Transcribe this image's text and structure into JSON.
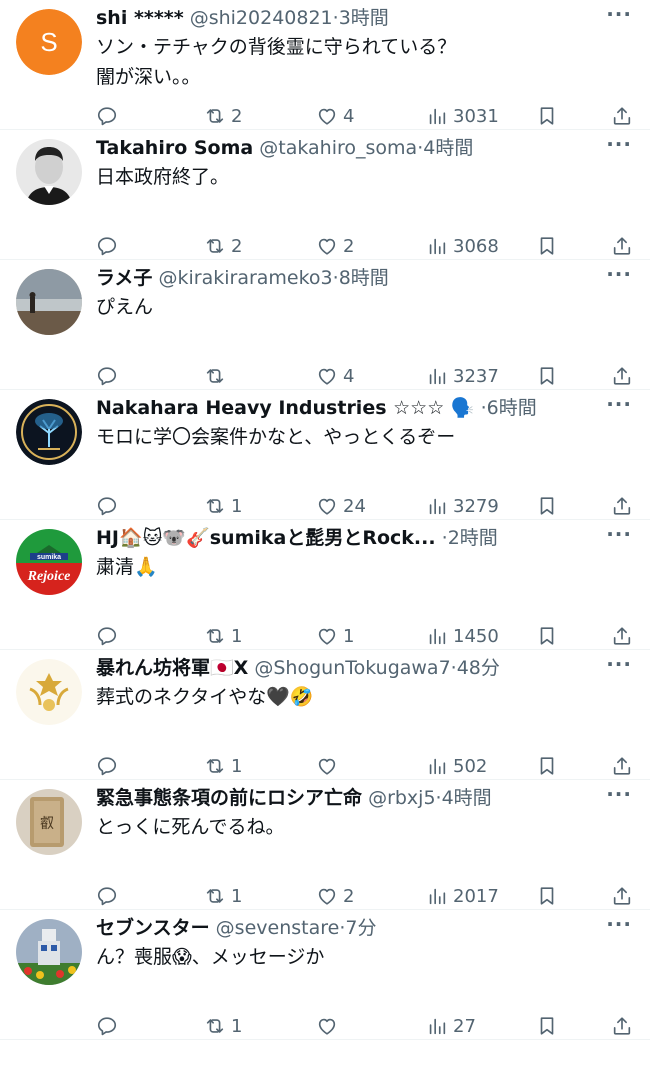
{
  "tweets": [
    {
      "name": "shi *****",
      "handle": "@shi20240821",
      "dot": "·",
      "time": "3時間",
      "text": "ソン・テチャクの背後霊に守られている？\n闇が深い。。",
      "replies": "",
      "retweets": "2",
      "likes": "4",
      "views": "3031",
      "avatar": "avatar-s-orange",
      "avatar_letter": "S",
      "avatar_color": "#f4811f"
    },
    {
      "name": "Takahiro Soma",
      "handle": "@takahiro_soma",
      "dot": "·",
      "time": "4時間",
      "text": "日本政府終了。",
      "replies": "",
      "retweets": "2",
      "likes": "2",
      "views": "3068",
      "avatar": "avatar-portrait-bw"
    },
    {
      "name": "ラメ子",
      "handle": "@kirakirarameko3",
      "dot": "·",
      "time": "8時間",
      "text": "ぴえん",
      "replies": "",
      "retweets": "",
      "likes": "4",
      "views": "3237",
      "avatar": "avatar-beach-silhouette"
    },
    {
      "name": "Nakahara Heavy Industries ☆☆☆ 🗣️",
      "handle": "",
      "dot": "·",
      "time": "6時間",
      "text": "モロに学〇会案件かなと、やっとくるぞー",
      "replies": "",
      "retweets": "1",
      "likes": "24",
      "views": "3279",
      "avatar": "avatar-tree-of-life"
    },
    {
      "name": "HJ🏠🐱🐨🎸sumikaと髭男とRock...",
      "handle": "",
      "dot": "·",
      "time": "2時間",
      "text": "粛清🙏",
      "replies": "",
      "retweets": "1",
      "likes": "1",
      "views": "1450",
      "avatar": "avatar-sumika-rejoice",
      "avatar_top": "sumika",
      "avatar_bottom": "Rejoice"
    },
    {
      "name": "暴れん坊将軍🇯🇵X",
      "handle": "@ShogunTokugawa7",
      "dot": "·",
      "time": "48分",
      "text": "葬式のネクタイやな🖤🤣",
      "replies": "",
      "retweets": "1",
      "likes": "",
      "views": "502",
      "avatar": "avatar-gold-crest"
    },
    {
      "name": "緊急事態条項の前にロシア亡命",
      "handle": "@rbxj5",
      "dot": "·",
      "time": "4時間",
      "text": "とっくに死んでるね。",
      "replies": "",
      "retweets": "1",
      "likes": "2",
      "views": "2017",
      "avatar": "avatar-wood-tablet",
      "avatar_glyph": "叡"
    },
    {
      "name": "セブンスター",
      "handle": "@sevenstare",
      "dot": "·",
      "time": "7分",
      "text": "ん？喪服😱、メッセージか",
      "replies": "",
      "retweets": "1",
      "likes": "",
      "views": "27",
      "avatar": "avatar-robot-statue"
    }
  ],
  "icons": {
    "reply": "reply-icon",
    "retweet": "retweet-icon",
    "like": "heart-icon",
    "views": "views-icon",
    "bookmark": "bookmark-icon",
    "share": "share-icon",
    "more": "more-icon"
  },
  "more_glyph": "···"
}
